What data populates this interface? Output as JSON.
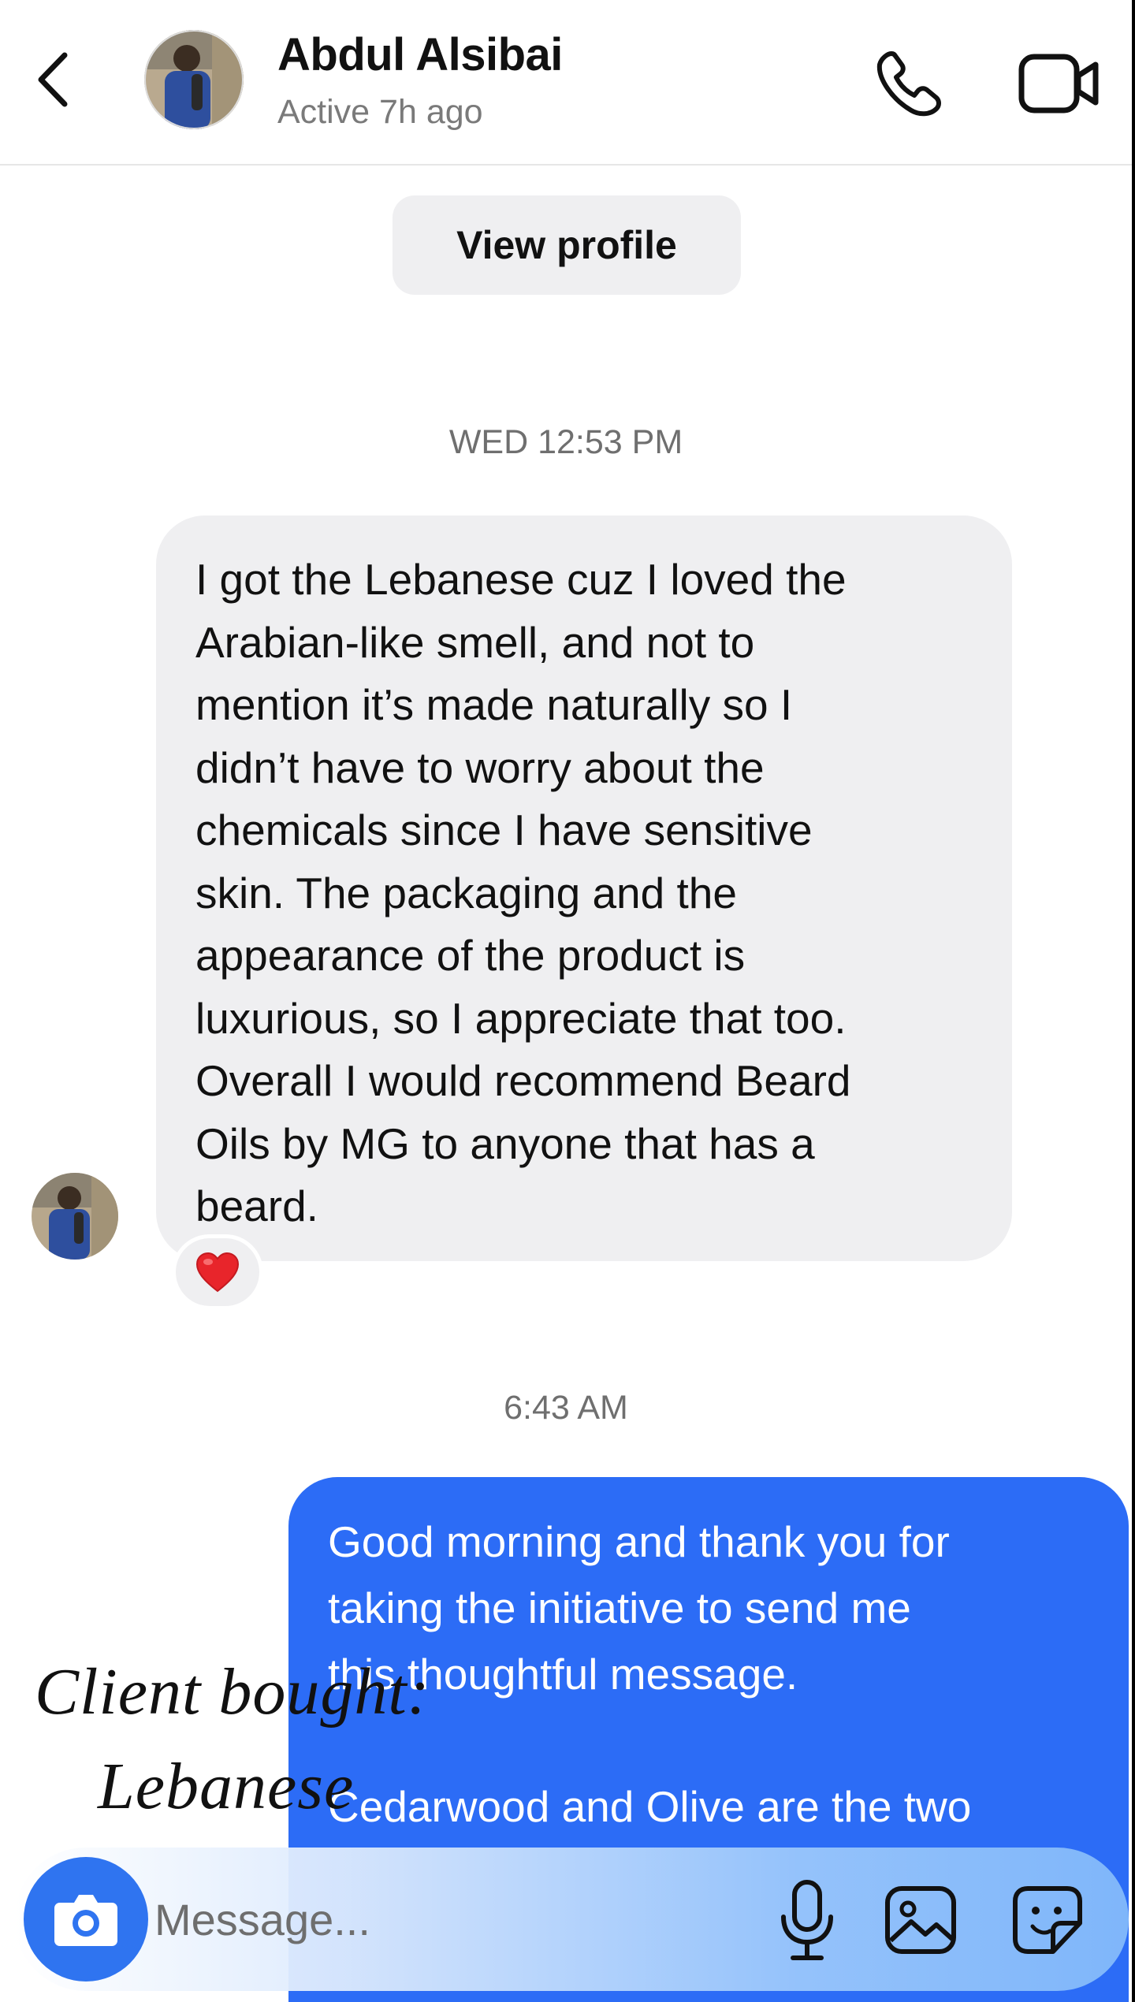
{
  "header": {
    "contact_name": "Abdul Alsibai",
    "status": "Active 7h ago",
    "icons": {
      "back": "chevron-left-icon",
      "call": "phone-icon",
      "video": "video-camera-icon"
    }
  },
  "view_profile_label": "View profile",
  "conversation": {
    "timestamp_1": "WED 12:53 PM",
    "received_message": "I got the Lebanese cuz I loved the\nArabian-like smell, and not to\nmention it’s made naturally so I\ndidn’t have to worry about the\nchemicals since I have sensitive\nskin. The packaging and the\nappearance of the product is\nluxurious, so I appreciate that too.\nOverall I would recommend Beard\nOils by MG to anyone that has a\nbeard.",
    "reaction": "❤️",
    "timestamp_2": "6:43 AM",
    "sent_message": {
      "line_1": "Good morning and thank you for",
      "line_2": "taking the initiative to send me",
      "line_3": "this thoughtful message.",
      "line_4": "Cedarwood and Olive are the two"
    }
  },
  "overlay_caption": {
    "line_1": "Client bought:",
    "line_2": "Lebanese"
  },
  "composer": {
    "placeholder": "Message...",
    "icons": [
      "camera-icon",
      "microphone-icon",
      "gallery-icon",
      "sticker-icon"
    ]
  },
  "colors": {
    "sent_bubble": "#2c6cf6",
    "received_bubble": "#efeff1",
    "camera_button": "#2f74f0",
    "reaction_heart": "#e8252b"
  }
}
